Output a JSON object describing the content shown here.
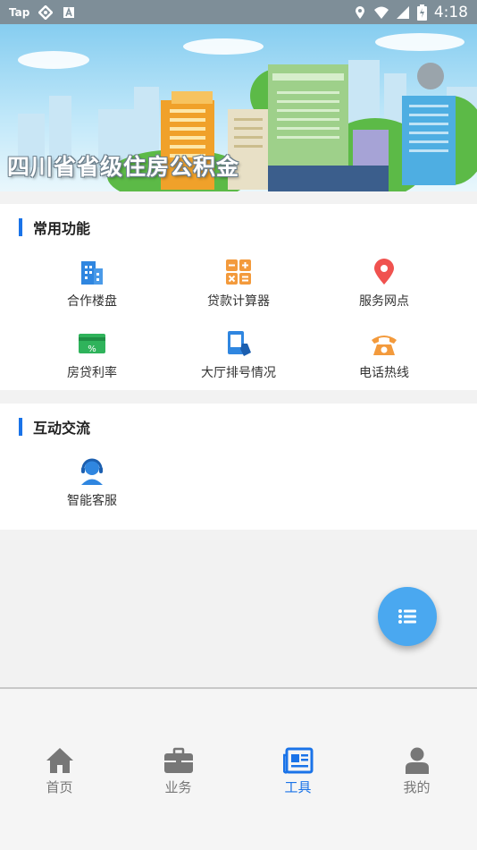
{
  "status_bar": {
    "app_label": "Tap",
    "time": "4:18"
  },
  "banner": {
    "title": "四川省省级住房公积金"
  },
  "sections": {
    "common": {
      "title": "常用功能",
      "items": [
        {
          "label": "合作楼盘",
          "icon": "building-icon",
          "color": "#2f86e0"
        },
        {
          "label": "贷款计算器",
          "icon": "calculator-icon",
          "color": "#f39a3c"
        },
        {
          "label": "服务网点",
          "icon": "location-pin-icon",
          "color": "#f0524f"
        },
        {
          "label": "房贷利率",
          "icon": "rate-card-icon",
          "color": "#2fb35b"
        },
        {
          "label": "大厅排号情况",
          "icon": "queue-ticket-icon",
          "color": "#2f86e0"
        },
        {
          "label": "电话热线",
          "icon": "telephone-icon",
          "color": "#f39a3c"
        }
      ]
    },
    "interact": {
      "title": "互动交流",
      "items": [
        {
          "label": "智能客服",
          "icon": "customer-service-icon",
          "color": "#2f86e0"
        }
      ]
    }
  },
  "bottom_nav": {
    "items": [
      {
        "label": "首页",
        "icon": "home-icon"
      },
      {
        "label": "业务",
        "icon": "briefcase-icon"
      },
      {
        "label": "工具",
        "icon": "newspaper-icon",
        "active": true
      },
      {
        "label": "我的",
        "icon": "person-icon"
      }
    ],
    "active_color": "#1a73e8",
    "inactive_color": "#777777"
  },
  "fab": {
    "icon": "list-menu-icon",
    "color": "#4aa8f0"
  }
}
